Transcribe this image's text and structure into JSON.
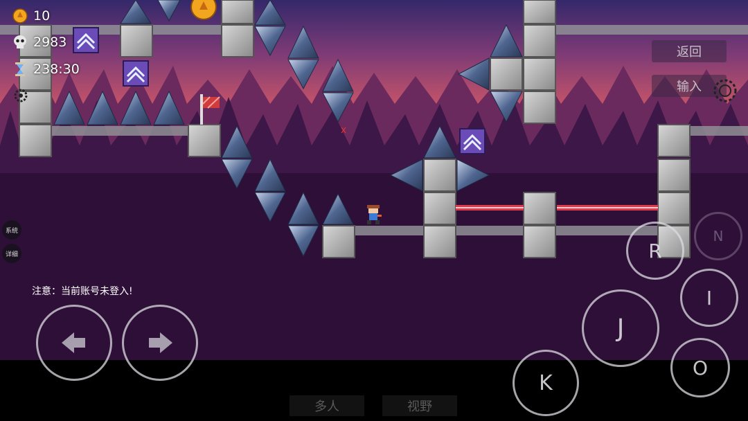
{
  "hud": {
    "coins": "10",
    "deaths": "2983",
    "timer": "238:30",
    "coin_icon": "coin-icon",
    "death_icon": "skull-icon",
    "timer_icon": "hourglass-icon"
  },
  "menu": {
    "back_label": "返回",
    "input_label": "输入"
  },
  "side": {
    "system_label": "系统",
    "detail_label": "详细"
  },
  "notice": "注意：当前账号未登入!",
  "controls": {
    "r": "R",
    "n": "N",
    "i": "I",
    "j": "J",
    "k": "K",
    "o": "O"
  },
  "bottom": {
    "multiplayer_label": "多人",
    "view_label": "视野"
  },
  "colors": {
    "sky_top": "#2a1f5a",
    "sky_mid": "#c24e6a",
    "forest_dark": "#2a1238",
    "ground_purple": "#2e0f38",
    "block_gray": "#a7a7a7",
    "spike_blue": "#3b4f78",
    "laser_red": "#e0394a",
    "jump_pad": "#6a4bb8"
  }
}
